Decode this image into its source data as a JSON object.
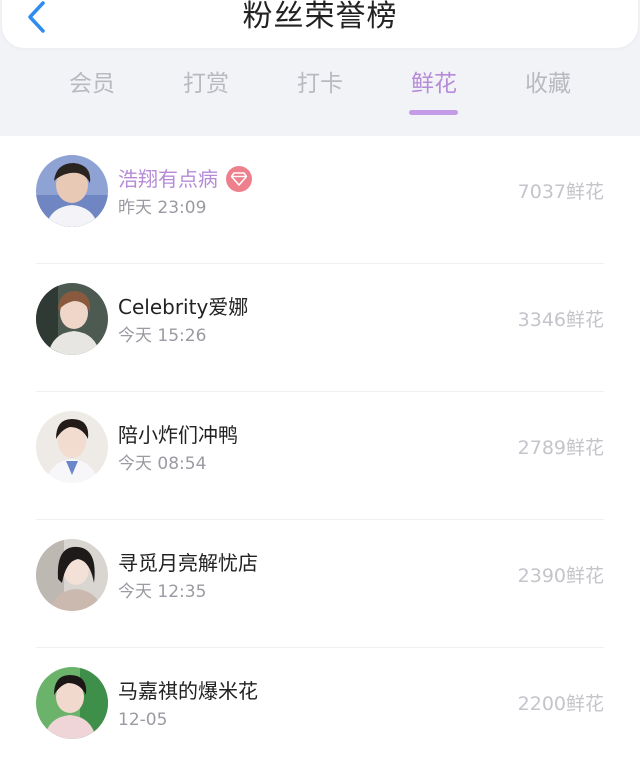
{
  "header": {
    "title": "粉丝荣誉榜",
    "back_icon": "chevron-left-icon",
    "accent": "#2e8bf0"
  },
  "tabs": [
    {
      "label": "会员",
      "active": false
    },
    {
      "label": "打赏",
      "active": false
    },
    {
      "label": "打卡",
      "active": false
    },
    {
      "label": "鲜花",
      "active": true
    },
    {
      "label": "收藏",
      "active": false
    }
  ],
  "colors": {
    "active_tab": "#b58bd8",
    "inactive_tab": "#b9b9c0",
    "vip_name": "#b58bd8",
    "badge": "#ee7f8c",
    "count": "#c4c4ca"
  },
  "list": {
    "items": [
      {
        "name": "浩翔有点病",
        "time": "昨天 23:09",
        "count": "7037鲜花",
        "vip": true,
        "badge_icon": "diamond-icon"
      },
      {
        "name": "Celebrity爱娜",
        "time": "今天 15:26",
        "count": "3346鲜花",
        "vip": false
      },
      {
        "name": "陪小炸们冲鸭",
        "time": "今天 08:54",
        "count": "2789鲜花",
        "vip": false
      },
      {
        "name": "寻觅月亮解忧店",
        "time": "今天 12:35",
        "count": "2390鲜花",
        "vip": false
      },
      {
        "name": "马嘉祺的爆米花",
        "time": "12-05",
        "count": "2200鲜花",
        "vip": false
      }
    ]
  }
}
